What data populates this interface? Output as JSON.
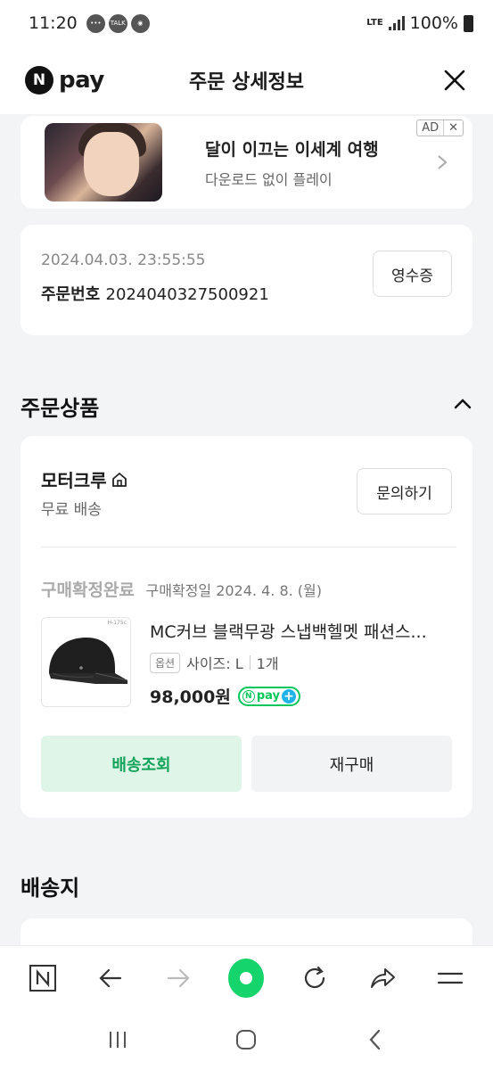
{
  "status_bar": {
    "time": "11:20",
    "notif_icons": [
      "chat-icon",
      "talk-icon",
      "messenger-icon"
    ],
    "talk_label": "TALK",
    "lte_label": "LTE",
    "battery": "100%"
  },
  "header": {
    "logo_n": "N",
    "logo_text": "pay",
    "title": "주문 상세정보"
  },
  "ad": {
    "title": "달이 이끄는 이세계 여행",
    "subtitle": "다운로드 없이 플레이",
    "badge": "AD",
    "badge_close": "✕"
  },
  "order": {
    "date": "2024.04.03. 23:55:55",
    "number_label": "주문번호",
    "number": "2024040327500921",
    "receipt_button": "영수증"
  },
  "products_section": {
    "title": "주문상품",
    "seller": "모터크루",
    "shipping": "무료 배송",
    "inquiry_button": "문의하기",
    "status": "구매확정완료",
    "confirm_date": "구매확정일 2024. 4. 8. (월)",
    "item": {
      "name": "MC커브 블랙무광 스냅백헬멧 패션스...",
      "option_tag": "옵션",
      "option_value": "사이즈: L",
      "quantity": "1개",
      "price": "98,000원",
      "size_tag": "H-175c"
    },
    "npay_badge": "pay",
    "track_button": "배송조회",
    "rebuy_button": "재구매"
  },
  "address_section": {
    "title": "배송지"
  },
  "browser_bar": {
    "n_button": "N"
  }
}
